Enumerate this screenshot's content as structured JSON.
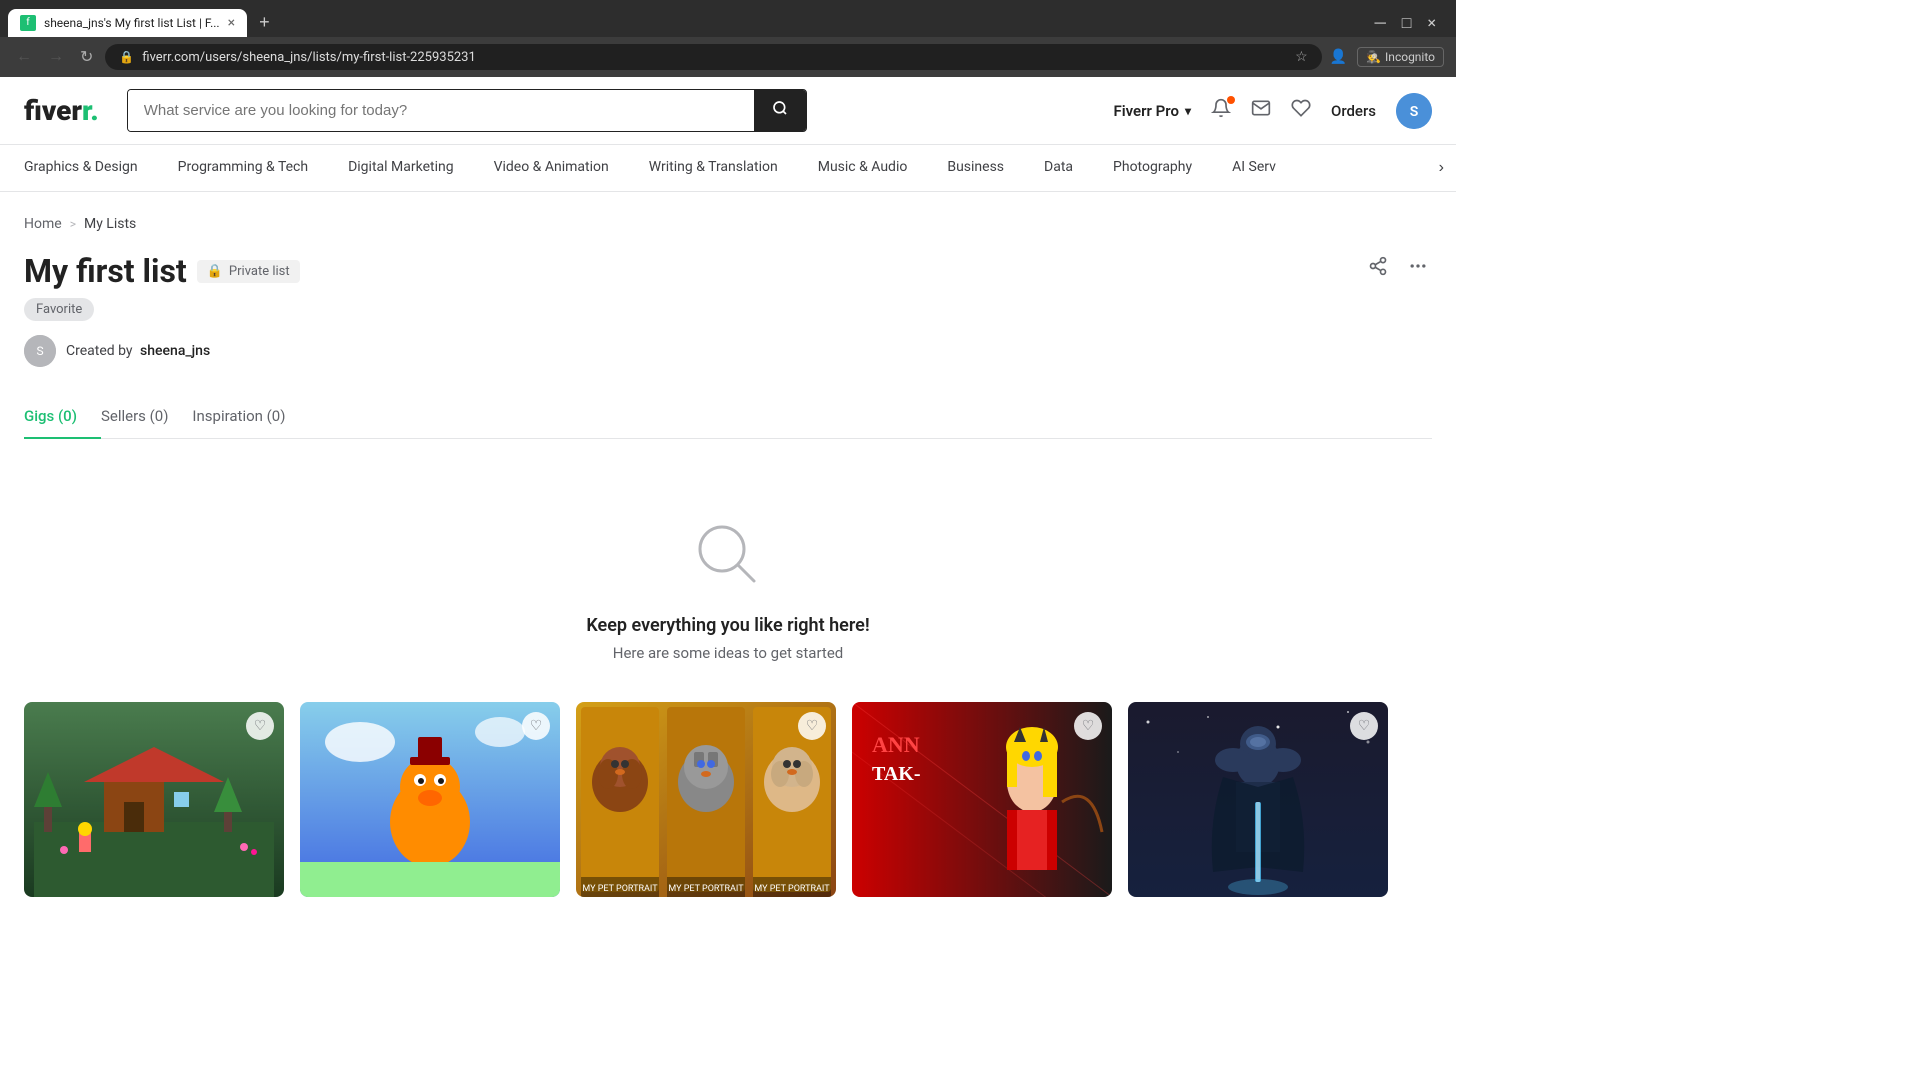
{
  "browser": {
    "tab_title": "sheena_jns's My first list List | F...",
    "tab_close": "×",
    "tab_new": "+",
    "win_minimize": "─",
    "win_maximize": "□",
    "win_close": "×",
    "nav_back": "←",
    "nav_forward": "→",
    "nav_refresh": "↻",
    "address_url": "fiverr.com/users/sheena_jns/lists/my-first-list-225935231",
    "incognito_label": "Incognito"
  },
  "header": {
    "logo": "fiverr",
    "logo_dot": ".",
    "search_placeholder": "What service are you looking for today?",
    "fiverr_pro_label": "Fiverr Pro",
    "notifications_label": "Notifications",
    "messages_label": "Messages",
    "wishlist_label": "Wishlist",
    "orders_label": "Orders",
    "user_initials": "S"
  },
  "categories": [
    {
      "label": "Graphics & Design",
      "id": "graphics-design"
    },
    {
      "label": "Programming & Tech",
      "id": "programming-tech"
    },
    {
      "label": "Digital Marketing",
      "id": "digital-marketing"
    },
    {
      "label": "Video & Animation",
      "id": "video-animation"
    },
    {
      "label": "Writing & Translation",
      "id": "writing-translation"
    },
    {
      "label": "Music & Audio",
      "id": "music-audio"
    },
    {
      "label": "Business",
      "id": "business"
    },
    {
      "label": "Data",
      "id": "data"
    },
    {
      "label": "Photography",
      "id": "photography"
    },
    {
      "label": "AI Serv",
      "id": "ai-services"
    }
  ],
  "breadcrumb": {
    "home": "Home",
    "separator": ">",
    "current": "My Lists"
  },
  "list": {
    "title": "My first list",
    "private_label": "Private list",
    "tag": "Favorite",
    "creator_prefix": "Created by",
    "creator_name": "sheena_jns",
    "share_icon": "share",
    "more_icon": "⋯"
  },
  "tabs": [
    {
      "label": "Gigs (0)",
      "id": "gigs",
      "active": true
    },
    {
      "label": "Sellers (0)",
      "id": "sellers",
      "active": false
    },
    {
      "label": "Inspiration (0)",
      "id": "inspiration",
      "active": false
    }
  ],
  "empty_state": {
    "title": "Keep everything you like right here!",
    "subtitle": "Here are some ideas to get started"
  },
  "cards": [
    {
      "id": "card-1",
      "color_top": "#4a7c4e",
      "color_bottom": "#1a4a2e",
      "accent": "#7bcf7b"
    },
    {
      "id": "card-2",
      "color_top": "#87ceeb",
      "color_bottom": "#4169e1",
      "accent": "#ff8c00"
    },
    {
      "id": "card-3",
      "color_top": "#d4a017",
      "color_bottom": "#8b6914",
      "accent": "#ffd700"
    },
    {
      "id": "card-4",
      "color_top": "#cc0000",
      "color_bottom": "#660000",
      "accent": "#ff4444"
    },
    {
      "id": "card-5",
      "color_top": "#1a1a2e",
      "color_bottom": "#16213e",
      "accent": "#e94560"
    }
  ]
}
